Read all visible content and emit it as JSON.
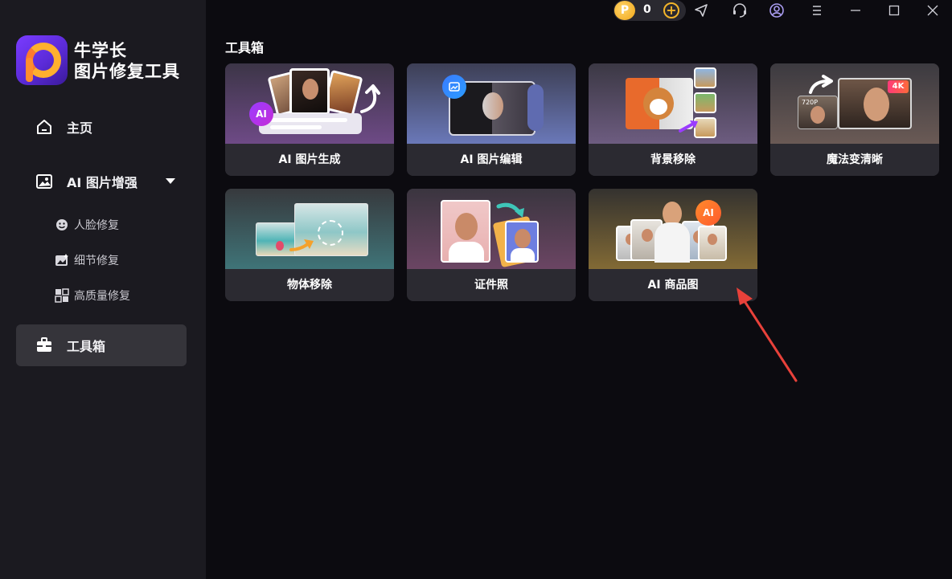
{
  "app": {
    "name_line1": "牛学长",
    "name_line2": "图片修复工具"
  },
  "titlebar": {
    "coin_symbol": "P",
    "coin_count": "0",
    "plus_symbol": "+"
  },
  "sidebar": {
    "home_label": "主页",
    "enhance_label": "AI 图片增强",
    "sub_items": [
      {
        "label": "人脸修复",
        "icon": "face-smile-icon"
      },
      {
        "label": "细节修复",
        "icon": "image-sparkle-icon"
      },
      {
        "label": "高质量修复",
        "icon": "image-quality-icon"
      }
    ],
    "toolbox_label": "工具箱"
  },
  "main": {
    "section_title": "工具箱",
    "cards": [
      {
        "label": "AI 图片生成",
        "badge": "AI"
      },
      {
        "label": "AI 图片编辑"
      },
      {
        "label": "背景移除"
      },
      {
        "label": "魔法变清晰",
        "badge_left": "720P",
        "badge_right": "4K"
      },
      {
        "label": "物体移除"
      },
      {
        "label": "证件照"
      },
      {
        "label": "AI 商品图",
        "badge": "AI"
      }
    ]
  },
  "colors": {
    "accent_purple": "#7a3cff",
    "coin_gold": "#f3b52a",
    "annotation_red": "#e8413a",
    "sidebar_bg": "#1b1a20",
    "main_bg": "#0c0b10"
  }
}
